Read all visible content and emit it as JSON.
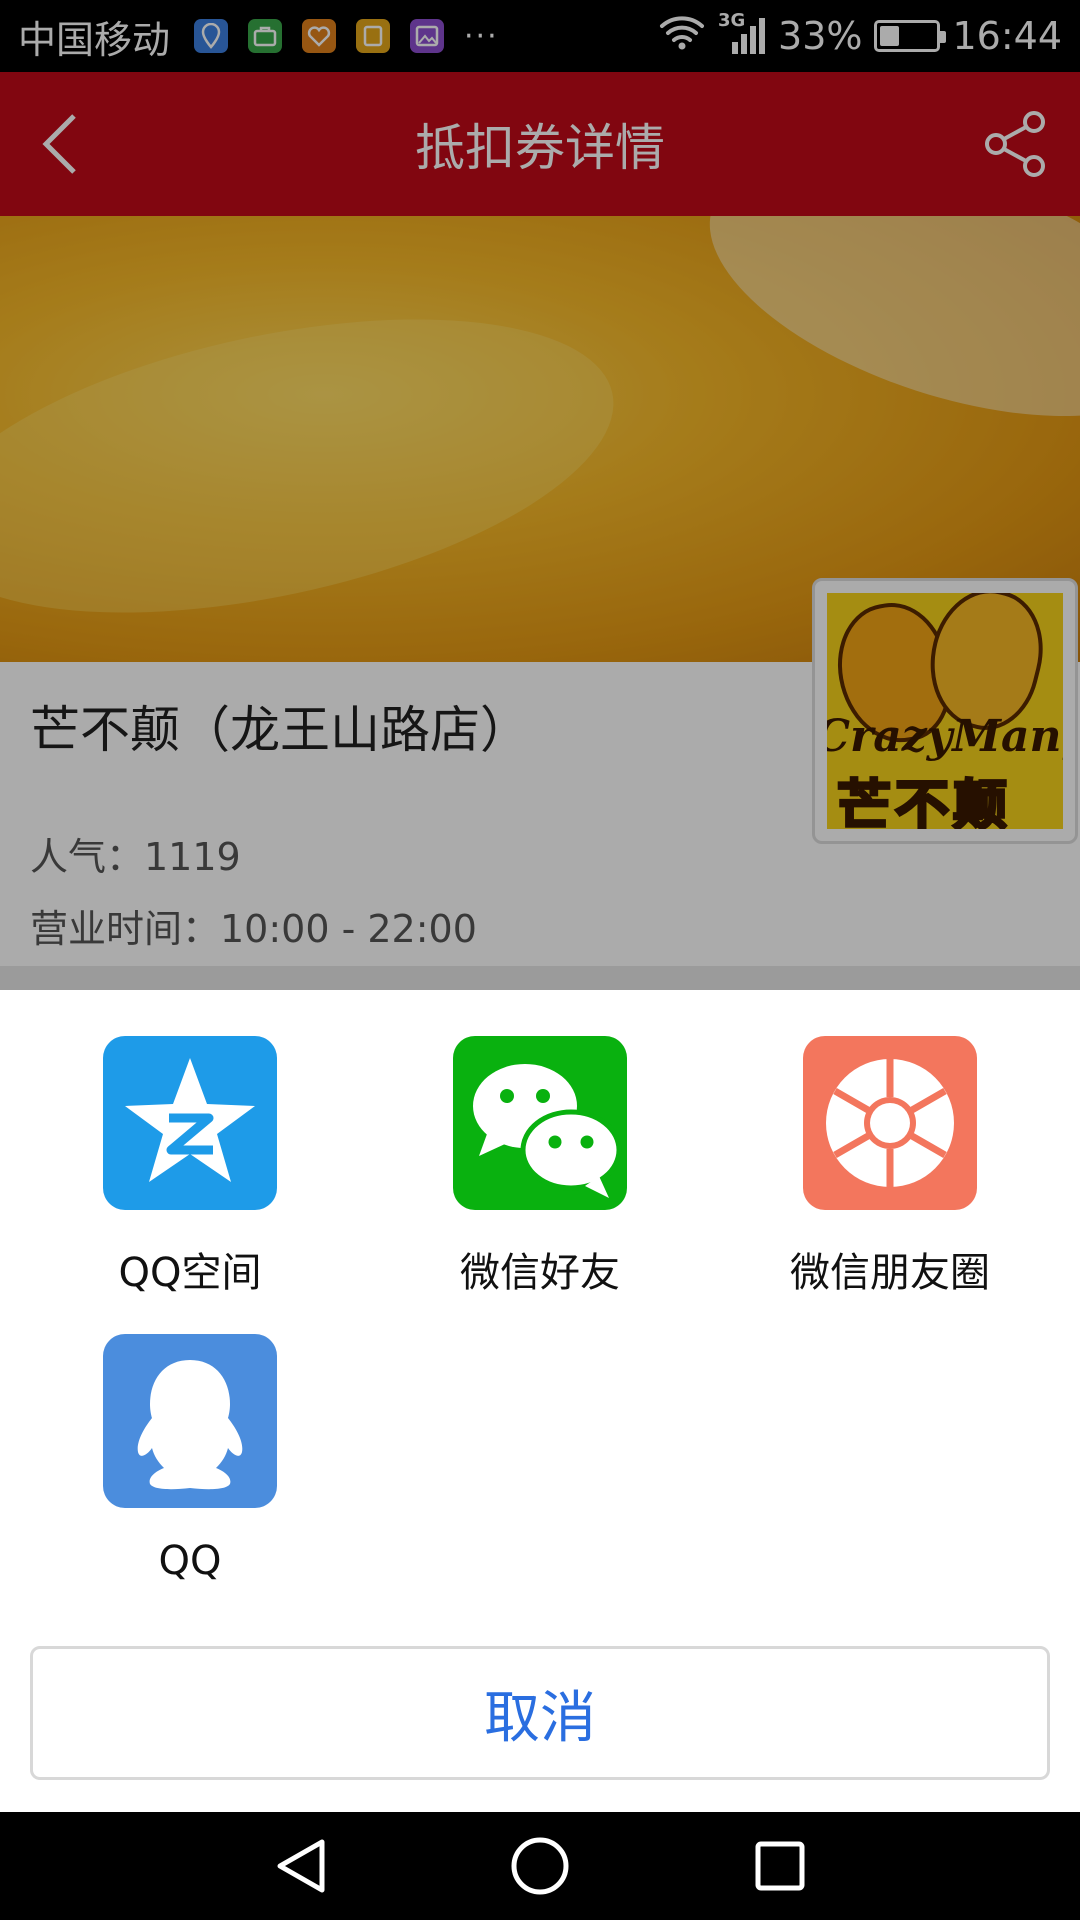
{
  "status_bar": {
    "carrier": "中国移动",
    "network": "3G",
    "battery": "33%",
    "battery_level": 0.33,
    "time": "16:44",
    "overflow": "···"
  },
  "app_bar": {
    "title": "抵扣券详情"
  },
  "shop": {
    "name": "芒不颠（龙王山路店）",
    "popularity": "人气：1119",
    "hours": "营业时间：10:00 - 22:00",
    "logo_text_en": "CrazyMango",
    "logo_text_cn": "芒不颠"
  },
  "share_sheet": {
    "items": [
      {
        "label": "QQ空间",
        "color": "#1e9be8",
        "icon": "qzone-icon"
      },
      {
        "label": "微信好友",
        "color": "#09b10f",
        "icon": "wechat-icon"
      },
      {
        "label": "微信朋友圈",
        "color": "#f3765d",
        "icon": "moments-icon"
      },
      {
        "label": "QQ",
        "color": "#4b8ddd",
        "icon": "qq-icon"
      }
    ],
    "cancel_label": "取消"
  },
  "colors": {
    "app_bar": "#c00a18",
    "cancel_text": "#2a6ee0"
  }
}
